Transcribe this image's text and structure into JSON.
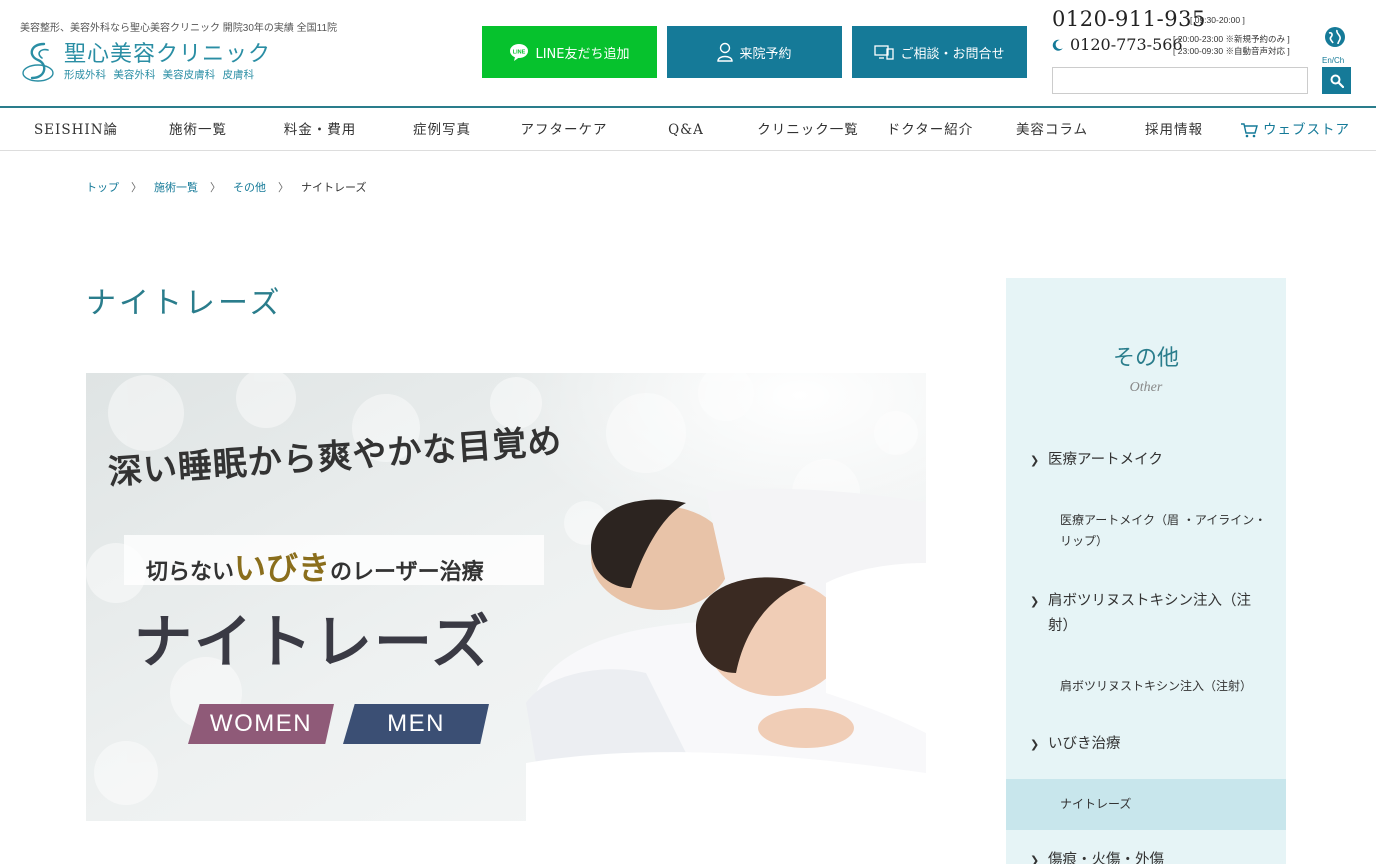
{
  "header": {
    "tagline": "美容整形、美容外科なら聖心美容クリニック 開院30年の実績 全国11院",
    "logo_name": "聖心美容クリニック",
    "logo_sub": "形成外科 美容外科 美容皮膚科 皮膚科",
    "buttons": {
      "line": "LINE友だち追加",
      "reserve": "来院予約",
      "contact": "ご相談・お問合せ"
    },
    "tel_main": "0120-911-935",
    "tel_hours": "[ 09:30-20:00 ]",
    "tel_night": "0120-773-566",
    "tel_note_1": "[ 20:00-23:00 ※新規予約のみ ]",
    "tel_note_2": "[ 23:00-09:30 ※自動音声対応 ]",
    "lang": "En/Ch",
    "search_placeholder": ""
  },
  "nav": {
    "items": [
      "SEISHIN論",
      "施術一覧",
      "料金・費用",
      "症例写真",
      "アフターケア",
      "Q&A",
      "クリニック一覧",
      "ドクター紹介",
      "美容コラム",
      "採用情報",
      "ウェブストア"
    ]
  },
  "breadcrumb": {
    "items": [
      "トップ",
      "施術一覧",
      "その他"
    ],
    "separator": "〉",
    "current": "ナイトレーズ"
  },
  "main": {
    "title": "ナイトレーズ",
    "hero": {
      "line1": "深い睡眠から爽やかな目覚め",
      "line2_pre": "切らない",
      "line2_hl": "いびき",
      "line2_post": "のレーザー治療",
      "line3": "ナイトレーズ",
      "badge_women": "WOMEN",
      "badge_men": "MEN"
    }
  },
  "sidebar": {
    "title": "その他",
    "subtitle": "Other",
    "cat1": "医療アートメイク",
    "cat1_sub": "医療アートメイク（眉 ・アイライン・リップ）",
    "cat2": "肩ボツリヌストキシン注入（注射）",
    "cat2_sub": "肩ボツリヌストキシン注入（注射）",
    "cat3": "いびき治療",
    "cat3_active": "ナイトレーズ",
    "cat4": "傷痕・火傷・外傷"
  },
  "colors": {
    "accent": "#157a98",
    "title": "#2a7d8c",
    "line_green": "#06c22d",
    "sidebar_bg": "#e6f4f6",
    "sidebar_active": "#c8e6ec"
  }
}
